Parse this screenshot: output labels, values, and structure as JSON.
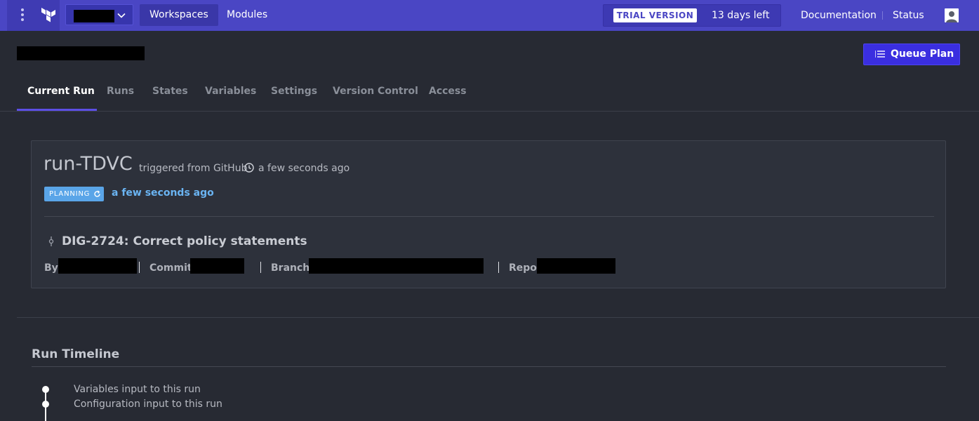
{
  "topbar": {
    "nav": {
      "workspaces": "Workspaces",
      "modules": "Modules"
    },
    "trial": {
      "badge": "TRIAL VERSION",
      "days_left": "13 days left"
    },
    "links": {
      "documentation": "Documentation",
      "status": "Status"
    }
  },
  "workspace": {
    "queue_plan_label": "Queue Plan"
  },
  "tabs": [
    {
      "label": "Current Run",
      "active": true
    },
    {
      "label": "Runs"
    },
    {
      "label": "States"
    },
    {
      "label": "Variables"
    },
    {
      "label": "Settings"
    },
    {
      "label": "Version Control"
    },
    {
      "label": "Access"
    }
  ],
  "run": {
    "id": "run-TDVC",
    "trigger": "triggered from GitHub",
    "time_ago": "a few seconds ago",
    "status": "PLANNING",
    "status_time": "a few seconds ago",
    "commit_title": "DIG-2724: Correct policy statements",
    "meta": {
      "by": "By",
      "commit": "Commit",
      "branch": "Branch",
      "repo": "Repo"
    }
  },
  "timeline": {
    "heading": "Run Timeline",
    "items": [
      {
        "label": "Variables input to this run"
      },
      {
        "label": "Configuration input to this run"
      }
    ]
  },
  "colors": {
    "topbar": "#4a46c4",
    "page_bg": "#272a33",
    "card_bg": "#2d313b",
    "primary_button": "#3a2ee0",
    "planning": "#5aa5e8",
    "tab_active_underline": "#5c4ee5"
  },
  "icons": [
    "menu-dots-icon",
    "terraform-logo-icon",
    "chevron-down-icon",
    "user-avatar-icon",
    "queue-plan-icon",
    "clock-icon",
    "sync-icon",
    "commit-icon"
  ]
}
